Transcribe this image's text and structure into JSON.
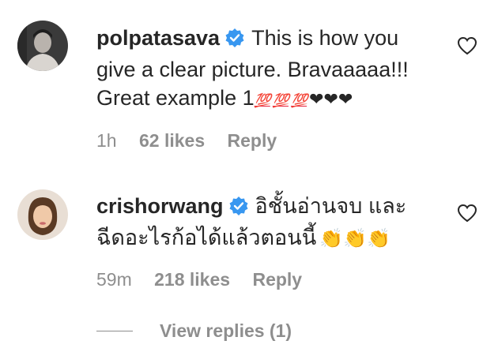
{
  "comments": [
    {
      "username": "polpatasava",
      "text_line1": "This is how you",
      "text_line2": "give a clear picture. Bravaaaaa!!!",
      "text_line3": "Great example 1",
      "hundred_emoji": "💯",
      "hearts": "❤❤❤",
      "time": "1h",
      "likes": "62 likes",
      "reply": "Reply",
      "avatar_icon": "profile-photo-man",
      "verified_icon": "verified-badge-icon"
    },
    {
      "username": "crishorwang",
      "text_line1": "อิชั้นอ่านจบ และ",
      "text_line2": "ฉีดอะไรก้อได้แล้วตอนนี้",
      "claps": "👏👏👏",
      "time": "59m",
      "likes": "218 likes",
      "reply": "Reply",
      "avatar_icon": "profile-photo-woman",
      "verified_icon": "verified-badge-icon"
    }
  ],
  "view_replies": "View replies (1)",
  "colors": {
    "text": "#262626",
    "secondary": "#8e8e8e",
    "verified": "#3897f0",
    "hundred": "#e8253f"
  }
}
